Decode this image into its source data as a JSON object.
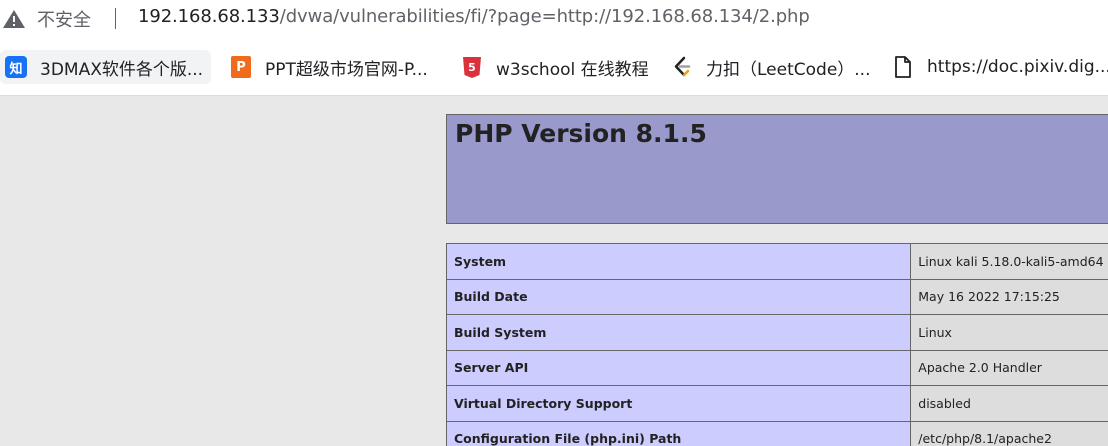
{
  "address_bar": {
    "security_label": "不安全",
    "url_host": "192.168.68.133",
    "url_rest": "/dvwa/vulnerabilities/fi/?page=http://192.168.68.134/2.php"
  },
  "bookmarks": [
    {
      "label": "3DMAX软件各个版...",
      "icon": "zhihu-icon"
    },
    {
      "label": "PPT超级市场官网-P...",
      "icon": "ppt-icon"
    },
    {
      "label": "w3school 在线教程",
      "icon": "w3school-icon"
    },
    {
      "label": "力扣（LeetCode）...",
      "icon": "leetcode-icon"
    },
    {
      "label": "https://doc.pixiv.dig...",
      "icon": "document-icon"
    }
  ],
  "phpinfo": {
    "title": "PHP Version 8.1.5",
    "rows": [
      {
        "key": "System",
        "value": "Linux kali 5.18.0-kali5-amd64 #"
      },
      {
        "key": "Build Date",
        "value": "May 16 2022 17:15:25"
      },
      {
        "key": "Build System",
        "value": "Linux"
      },
      {
        "key": "Server API",
        "value": "Apache 2.0 Handler"
      },
      {
        "key": "Virtual Directory Support",
        "value": "disabled"
      },
      {
        "key": "Configuration File (php.ini) Path",
        "value": "/etc/php/8.1/apache2"
      }
    ]
  },
  "colors": {
    "header_bg": "#9999cc",
    "key_bg": "#ccccff",
    "value_bg": "#dddddd"
  }
}
